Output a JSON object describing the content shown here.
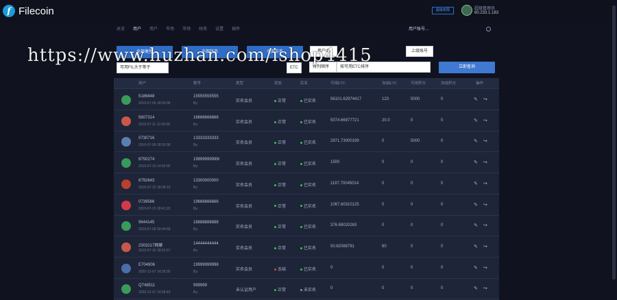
{
  "header": {
    "logo_icon": "f",
    "logo_text": "Filecoin",
    "member_button": "超级权限",
    "user_name": "超级管理员",
    "user_ip": "60.233.1.183"
  },
  "nav": {
    "items": [
      "总览",
      "用户",
      "用户",
      "市场",
      "市场",
      "财务",
      "设置",
      "插件"
    ],
    "search_placeholder": "用户账号..."
  },
  "filters": {
    "btn_all": "全部类型",
    "btn_status": "全部状态",
    "btn_identity": "全部实名",
    "input_id": "用户ID",
    "input_superior": "上级账号",
    "input_fil": "可用FIL大于等于",
    "input_etc": "ETC",
    "input_sort": "排列顺序",
    "input_sort_value": "按可用ETC排序",
    "search_button": "立即查询"
  },
  "watermark": "https://www.huzhan.com/ishop4415",
  "table": {
    "columns": [
      "用户",
      "账号",
      "类型",
      "状态",
      "实名",
      "可用ETC",
      "冻结ETC",
      "可用积分",
      "冻结积分",
      "操作"
    ],
    "rows": [
      {
        "avatar_color": "#3a9a5a",
        "name": "5186848",
        "date": "2019-07-09 18:00:08",
        "phone": "15555555555",
        "phone_sub": "By:",
        "type": "实名会员",
        "status": "正常",
        "status_color": "#3bbf5a",
        "identity": "已实名",
        "identity_color": "#3bbf5a",
        "etc": "56101.62974417",
        "frozen_etc": "123",
        "points": "5000",
        "frozen_points": "0"
      },
      {
        "avatar_color": "#c9574a",
        "name": "5607314",
        "date": "2019-07-11 12:50:08",
        "phone": "16666666666",
        "phone_sub": "By:",
        "type": "实名会员",
        "status": "正常",
        "status_color": "#3bbf5a",
        "identity": "已实名",
        "identity_color": "#3bbf5a",
        "etc": "5074.66977721",
        "frozen_etc": "20.0",
        "points": "0",
        "frozen_points": "0"
      },
      {
        "avatar_color": "#5b7fb0",
        "name": "0730716",
        "date": "2019-07-09 18:00:38",
        "phone": "13333333333",
        "phone_sub": "By:",
        "type": "实名会员",
        "status": "正常",
        "status_color": "#3bbf5a",
        "identity": "已实名",
        "identity_color": "#3bbf5a",
        "etc": "2871.73000199",
        "frozen_etc": "0",
        "points": "5000",
        "frozen_points": "0"
      },
      {
        "avatar_color": "#3a9a5a",
        "name": "8750274",
        "date": "2019-07-10 14:59:30",
        "phone": "19999999999/",
        "phone_sub": "By:",
        "type": "实名会员",
        "status": "正常",
        "status_color": "#3bbf5a",
        "identity": "已实名",
        "identity_color": "#3bbf5a",
        "etc": "1500",
        "frozen_etc": "0",
        "points": "0",
        "frozen_points": "0"
      },
      {
        "avatar_color": "#b8402e",
        "name": "8792643",
        "date": "2019-07-15 18:08:10",
        "phone": "13300000000",
        "phone_sub": "By:",
        "type": "实名会员",
        "status": "正常",
        "status_color": "#3bbf5a",
        "identity": "已实名",
        "identity_color": "#3bbf5a",
        "etc": "1187.70045014",
        "frozen_etc": "0",
        "points": "0",
        "frozen_points": "0"
      },
      {
        "avatar_color": "#d23a4a",
        "name": "0739566",
        "date": "2019-07-15 18:41:20",
        "phone": "19666666666",
        "phone_sub": "By:",
        "type": "实名会员",
        "status": "正常",
        "status_color": "#3bbf5a",
        "identity": "已实名",
        "identity_color": "#3bbf5a",
        "etc": "1067.60310125",
        "frozen_etc": "0",
        "points": "0",
        "frozen_points": "0"
      },
      {
        "avatar_color": "#3a9a5a",
        "name": "9644145",
        "date": "2019-07-09 00:04:58",
        "phone": "18888888888",
        "phone_sub": "By:",
        "type": "实名会员",
        "status": "正常",
        "status_color": "#3bbf5a",
        "identity": "已实名",
        "identity_color": "#3bbf5a",
        "etc": "376.69020263",
        "frozen_etc": "0",
        "points": "0",
        "frozen_points": "0"
      },
      {
        "avatar_color": "#c9574a",
        "name": "2303217网聊",
        "date": "2019-07-15 18:52:57",
        "phone": "14444444444",
        "phone_sub": "By:",
        "type": "实名会员",
        "status": "正常",
        "status_color": "#3bbf5a",
        "identity": "已实名",
        "identity_color": "#3bbf5a",
        "etc": "50.82088781",
        "frozen_etc": "60",
        "points": "0",
        "frozen_points": "0"
      },
      {
        "avatar_color": "#4b6ea8",
        "name": "E704906",
        "date": "2020-12-07 14:28:35",
        "phone": "19999999998",
        "phone_sub": "By:",
        "type": "实名会员",
        "status": "冻结",
        "status_color": "#e0433b",
        "identity": "已实名",
        "identity_color": "#3bbf5a",
        "etc": "0",
        "frozen_etc": "0",
        "points": "0",
        "frozen_points": "0"
      },
      {
        "avatar_color": "#3a9a5a",
        "name": "Q748511",
        "date": "2020-12-07 14:28:40",
        "phone": "999999",
        "phone_sub": "By:",
        "type": "未认证用户",
        "status": "正常",
        "status_color": "#3bbf5a",
        "identity": "未实名",
        "identity_color": "#8a92a8",
        "etc": "0",
        "frozen_etc": "0",
        "points": "0",
        "frozen_points": "0"
      }
    ],
    "edit_icon": "edit-icon",
    "login_icon": "login-icon"
  }
}
